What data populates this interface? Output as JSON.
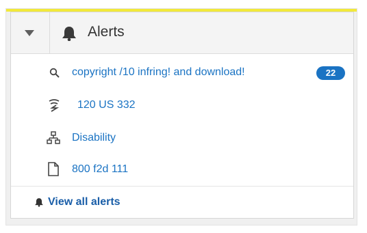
{
  "colors": {
    "accent": "#f2e93a",
    "link": "#1a73c3",
    "badge": "#1a73c3",
    "header_bg": "#f4f4f4"
  },
  "header": {
    "title": "Alerts",
    "collapse_icon": "triangle-down-icon",
    "title_icon": "bell-icon"
  },
  "alerts": [
    {
      "icon": "search-icon",
      "label": "copyright /10 infring! and download!",
      "badge": "22"
    },
    {
      "icon": "signal-icon",
      "label": "120 US 332"
    },
    {
      "icon": "hierarchy-icon",
      "label": "Disability"
    },
    {
      "icon": "document-icon",
      "label": "800 f2d 111"
    }
  ],
  "footer": {
    "icon": "bell-icon",
    "label": "View all alerts"
  }
}
